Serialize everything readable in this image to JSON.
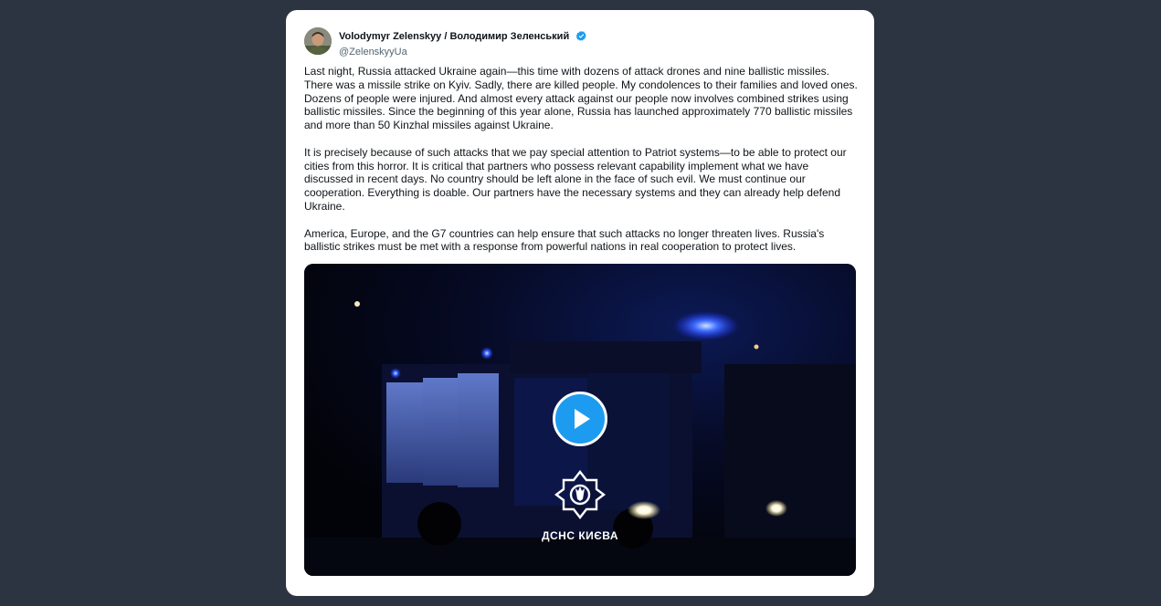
{
  "author": {
    "display_name": "Volodymyr Zelenskyy / Володимир Зеленський",
    "handle": "@ZelenskyyUa",
    "verified": true,
    "avatar_icon": "profile-photo"
  },
  "tweet": {
    "paragraphs": [
      "Last night, Russia attacked Ukraine again—this time with dozens of attack drones and nine ballistic missiles. There was a missile strike on Kyiv. Sadly, there are killed people. My condolences to their families and loved ones. Dozens of people were injured. And almost every attack against our people now involves combined strikes using ballistic missiles. Since the beginning of this year alone, Russia has launched approximately 770 ballistic missiles and more than 50 Kinzhal missiles against Ukraine.",
      "It is precisely because of such attacks that we pay special attention to Patriot systems—to be able to protect our cities from this horror. It is critical that partners who possess relevant capability implement what we have discussed in recent days. No country should be left alone in the face of such evil. We must continue our cooperation. Everything is doable. Our partners have the necessary systems and they can already help defend Ukraine.",
      "America, Europe, and the G7 countries can help ensure that such attacks no longer threaten lives. Russia's ballistic strikes must be met with a response from powerful nations in real cooperation to protect lives."
    ]
  },
  "media": {
    "type": "video",
    "play_icon": "play-icon",
    "watermark_label": "ДСНС КИЄВА",
    "watermark_icon": "dsns-emblem-icon"
  },
  "colors": {
    "page_background": "#2c3341",
    "card_background": "#ffffff",
    "accent": "#1d9bf0",
    "text_primary": "#0f1419",
    "text_secondary": "#536471"
  }
}
